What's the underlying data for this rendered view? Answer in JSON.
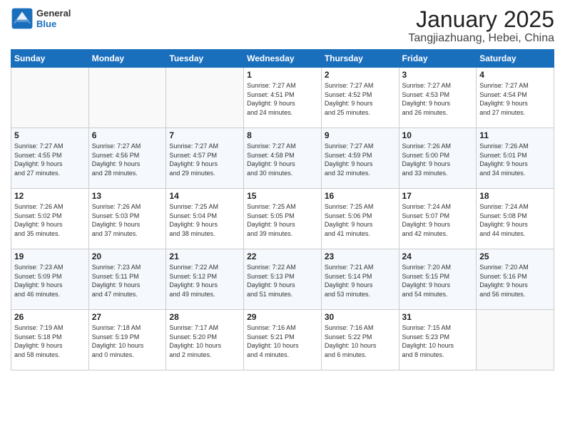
{
  "logo": {
    "line1": "General",
    "line2": "Blue"
  },
  "header": {
    "month": "January 2025",
    "location": "Tangjiazhuang, Hebei, China"
  },
  "weekdays": [
    "Sunday",
    "Monday",
    "Tuesday",
    "Wednesday",
    "Thursday",
    "Friday",
    "Saturday"
  ],
  "weeks": [
    [
      {
        "day": "",
        "info": ""
      },
      {
        "day": "",
        "info": ""
      },
      {
        "day": "",
        "info": ""
      },
      {
        "day": "1",
        "info": "Sunrise: 7:27 AM\nSunset: 4:51 PM\nDaylight: 9 hours\nand 24 minutes."
      },
      {
        "day": "2",
        "info": "Sunrise: 7:27 AM\nSunset: 4:52 PM\nDaylight: 9 hours\nand 25 minutes."
      },
      {
        "day": "3",
        "info": "Sunrise: 7:27 AM\nSunset: 4:53 PM\nDaylight: 9 hours\nand 26 minutes."
      },
      {
        "day": "4",
        "info": "Sunrise: 7:27 AM\nSunset: 4:54 PM\nDaylight: 9 hours\nand 27 minutes."
      }
    ],
    [
      {
        "day": "5",
        "info": "Sunrise: 7:27 AM\nSunset: 4:55 PM\nDaylight: 9 hours\nand 27 minutes."
      },
      {
        "day": "6",
        "info": "Sunrise: 7:27 AM\nSunset: 4:56 PM\nDaylight: 9 hours\nand 28 minutes."
      },
      {
        "day": "7",
        "info": "Sunrise: 7:27 AM\nSunset: 4:57 PM\nDaylight: 9 hours\nand 29 minutes."
      },
      {
        "day": "8",
        "info": "Sunrise: 7:27 AM\nSunset: 4:58 PM\nDaylight: 9 hours\nand 30 minutes."
      },
      {
        "day": "9",
        "info": "Sunrise: 7:27 AM\nSunset: 4:59 PM\nDaylight: 9 hours\nand 32 minutes."
      },
      {
        "day": "10",
        "info": "Sunrise: 7:26 AM\nSunset: 5:00 PM\nDaylight: 9 hours\nand 33 minutes."
      },
      {
        "day": "11",
        "info": "Sunrise: 7:26 AM\nSunset: 5:01 PM\nDaylight: 9 hours\nand 34 minutes."
      }
    ],
    [
      {
        "day": "12",
        "info": "Sunrise: 7:26 AM\nSunset: 5:02 PM\nDaylight: 9 hours\nand 35 minutes."
      },
      {
        "day": "13",
        "info": "Sunrise: 7:26 AM\nSunset: 5:03 PM\nDaylight: 9 hours\nand 37 minutes."
      },
      {
        "day": "14",
        "info": "Sunrise: 7:25 AM\nSunset: 5:04 PM\nDaylight: 9 hours\nand 38 minutes."
      },
      {
        "day": "15",
        "info": "Sunrise: 7:25 AM\nSunset: 5:05 PM\nDaylight: 9 hours\nand 39 minutes."
      },
      {
        "day": "16",
        "info": "Sunrise: 7:25 AM\nSunset: 5:06 PM\nDaylight: 9 hours\nand 41 minutes."
      },
      {
        "day": "17",
        "info": "Sunrise: 7:24 AM\nSunset: 5:07 PM\nDaylight: 9 hours\nand 42 minutes."
      },
      {
        "day": "18",
        "info": "Sunrise: 7:24 AM\nSunset: 5:08 PM\nDaylight: 9 hours\nand 44 minutes."
      }
    ],
    [
      {
        "day": "19",
        "info": "Sunrise: 7:23 AM\nSunset: 5:09 PM\nDaylight: 9 hours\nand 46 minutes."
      },
      {
        "day": "20",
        "info": "Sunrise: 7:23 AM\nSunset: 5:11 PM\nDaylight: 9 hours\nand 47 minutes."
      },
      {
        "day": "21",
        "info": "Sunrise: 7:22 AM\nSunset: 5:12 PM\nDaylight: 9 hours\nand 49 minutes."
      },
      {
        "day": "22",
        "info": "Sunrise: 7:22 AM\nSunset: 5:13 PM\nDaylight: 9 hours\nand 51 minutes."
      },
      {
        "day": "23",
        "info": "Sunrise: 7:21 AM\nSunset: 5:14 PM\nDaylight: 9 hours\nand 53 minutes."
      },
      {
        "day": "24",
        "info": "Sunrise: 7:20 AM\nSunset: 5:15 PM\nDaylight: 9 hours\nand 54 minutes."
      },
      {
        "day": "25",
        "info": "Sunrise: 7:20 AM\nSunset: 5:16 PM\nDaylight: 9 hours\nand 56 minutes."
      }
    ],
    [
      {
        "day": "26",
        "info": "Sunrise: 7:19 AM\nSunset: 5:18 PM\nDaylight: 9 hours\nand 58 minutes."
      },
      {
        "day": "27",
        "info": "Sunrise: 7:18 AM\nSunset: 5:19 PM\nDaylight: 10 hours\nand 0 minutes."
      },
      {
        "day": "28",
        "info": "Sunrise: 7:17 AM\nSunset: 5:20 PM\nDaylight: 10 hours\nand 2 minutes."
      },
      {
        "day": "29",
        "info": "Sunrise: 7:16 AM\nSunset: 5:21 PM\nDaylight: 10 hours\nand 4 minutes."
      },
      {
        "day": "30",
        "info": "Sunrise: 7:16 AM\nSunset: 5:22 PM\nDaylight: 10 hours\nand 6 minutes."
      },
      {
        "day": "31",
        "info": "Sunrise: 7:15 AM\nSunset: 5:23 PM\nDaylight: 10 hours\nand 8 minutes."
      },
      {
        "day": "",
        "info": ""
      }
    ]
  ]
}
